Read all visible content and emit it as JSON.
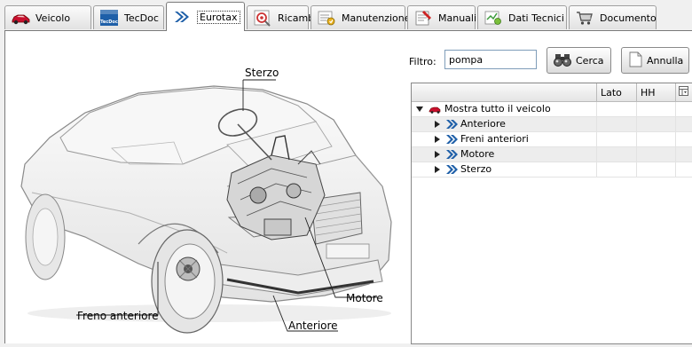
{
  "tabs": [
    {
      "label": "Veicolo",
      "icon": "car-icon",
      "active": false
    },
    {
      "label": "TecDoc",
      "icon": "tecdoc-logo-icon",
      "logo_text": "TecDoc",
      "active": false
    },
    {
      "label": "Eurotax",
      "icon": "chevron-double-icon",
      "active": true
    },
    {
      "label": "Ricamb",
      "icon": "parts-icon",
      "active": false
    },
    {
      "label": "Manutenzione",
      "icon": "maintenance-icon",
      "active": false
    },
    {
      "label": "Manuali",
      "icon": "manual-icon",
      "active": false
    },
    {
      "label": "Dati Tecnici",
      "icon": "technical-data-icon",
      "active": false
    },
    {
      "label": "Documento",
      "icon": "cart-icon",
      "active": false
    }
  ],
  "diagram": {
    "callouts": {
      "sterzo": "Sterzo",
      "motore": "Motore",
      "freno_anteriore": "Freno anteriore",
      "anteriore": "Anteriore"
    }
  },
  "filter": {
    "label": "Filtro:",
    "value": "pompa",
    "search_button": "Cerca",
    "cancel_button": "Annulla"
  },
  "tree": {
    "columns": [
      "",
      "Lato",
      "HH"
    ],
    "root": {
      "label": "Mostra tutto il veicolo",
      "expanded": true
    },
    "children": [
      {
        "label": "Anteriore",
        "expanded": false
      },
      {
        "label": "Freni anteriori",
        "expanded": false
      },
      {
        "label": "Motore",
        "expanded": false
      },
      {
        "label": "Sterzo",
        "expanded": false
      }
    ]
  },
  "colors": {
    "tab_border": "#a0a0a0",
    "accent_blue": "#1e5fa8",
    "car_red": "#c8102e"
  }
}
